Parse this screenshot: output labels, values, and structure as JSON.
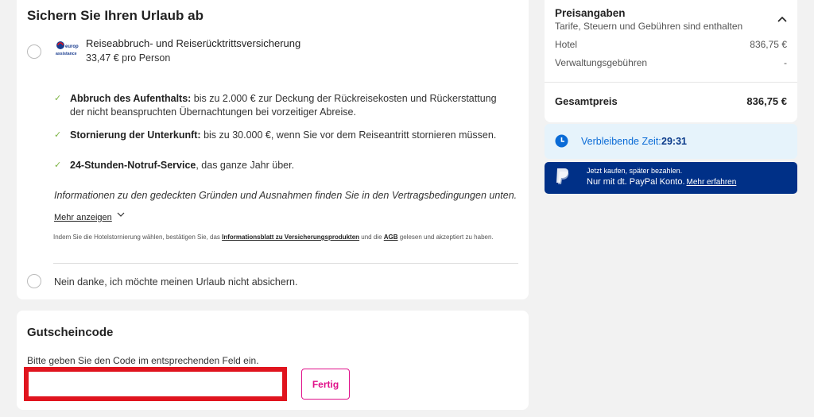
{
  "insurance": {
    "title": "Sichern Sie Ihren Urlaub ab",
    "logo_text_1": "europ",
    "logo_text_2": "assistance",
    "product_name": "Reiseabbruch- und Reiserücktrittsversicherung",
    "price": "33,47 € pro Person",
    "features": [
      {
        "bold": "Abbruch des Aufenthalts:",
        "text": " bis zu 2.000 € zur Deckung der Rückreisekosten und Rückerstattung der nicht beanspruchten Übernachtungen bei vorzeitiger Abreise."
      },
      {
        "bold": "Stornierung der Unterkunft:",
        "text": " bis zu 30.000 €, wenn Sie vor dem Reiseantritt stornieren müssen."
      },
      {
        "bold": "24-Stunden-Notruf-Service",
        "text": ", das ganze Jahr über."
      }
    ],
    "info_italic": "Informationen zu den gedeckten Gründen und Ausnahmen finden Sie in den Vertragsbedingungen unten.",
    "more_link": "Mehr anzeigen",
    "legal_prefix": "Indem Sie die Hotelstornierung wählen, bestätigen Sie, das ",
    "legal_link1": "Informationsblatt zu Versicherungsprodukten",
    "legal_mid": " und die ",
    "legal_link2": "AGB",
    "legal_suffix": " gelesen und akzeptiert zu haben.",
    "decline_label": "Nein danke, ich möchte meinen Urlaub nicht absichern."
  },
  "voucher": {
    "title": "Gutscheincode",
    "description": "Bitte geben Sie den Code im entsprechenden Feld ein.",
    "input_value": "",
    "button_label": "Fertig"
  },
  "price": {
    "title": "Preisangaben",
    "subtitle": "Tarife, Steuern und Gebühren sind enthalten",
    "rows": [
      {
        "label": "Hotel",
        "value": "836,75 €"
      },
      {
        "label": "Verwaltungsgebühren",
        "value": "-"
      }
    ],
    "total_label": "Gesamtpreis",
    "total_value": "836,75 €"
  },
  "timer": {
    "label": "Verbleibende Zeit:",
    "value": "29:31"
  },
  "paypal": {
    "line1": "Jetzt kaufen, später bezahlen.",
    "line2": "Nur mit dt. PayPal Konto.",
    "link": "Mehr erfahren"
  },
  "colors": {
    "accent_pink": "#e0108a",
    "highlight_red": "#e0141e",
    "check_green": "#7cb342",
    "timer_blue": "#0a6bd6",
    "paypal_navy": "#003087"
  }
}
